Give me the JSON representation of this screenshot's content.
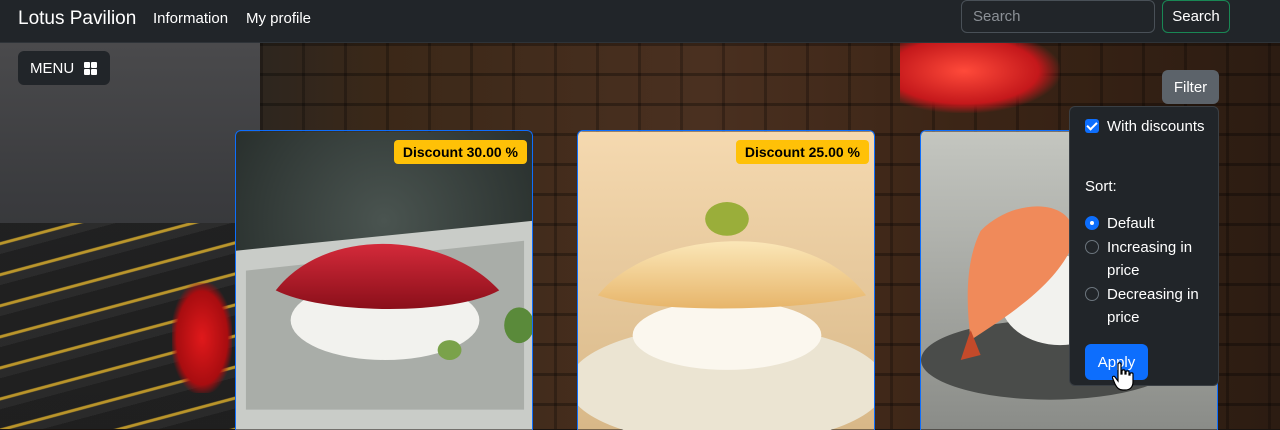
{
  "navbar": {
    "brand": "Lotus Pavilion",
    "links": [
      "Information",
      "My profile"
    ],
    "search_placeholder": "Search",
    "search_button": "Search"
  },
  "menu": {
    "label": "MENU",
    "icon": "grid-icon"
  },
  "filter": {
    "button_label": "Filter",
    "with_discounts_label": "With discounts",
    "with_discounts_checked": true,
    "sort_label": "Sort:",
    "sort_options": [
      "Default",
      "Increasing in price",
      "Decreasing in price"
    ],
    "sort_selected": "Default",
    "apply_label": "Apply"
  },
  "cards": [
    {
      "badge": "Discount 30.00 %"
    },
    {
      "badge": "Discount 25.00 %"
    },
    {
      "badge": ""
    }
  ],
  "colors": {
    "accent": "#0d6efd",
    "badge": "#ffc107",
    "navbar": "#212529",
    "success": "#198754"
  }
}
